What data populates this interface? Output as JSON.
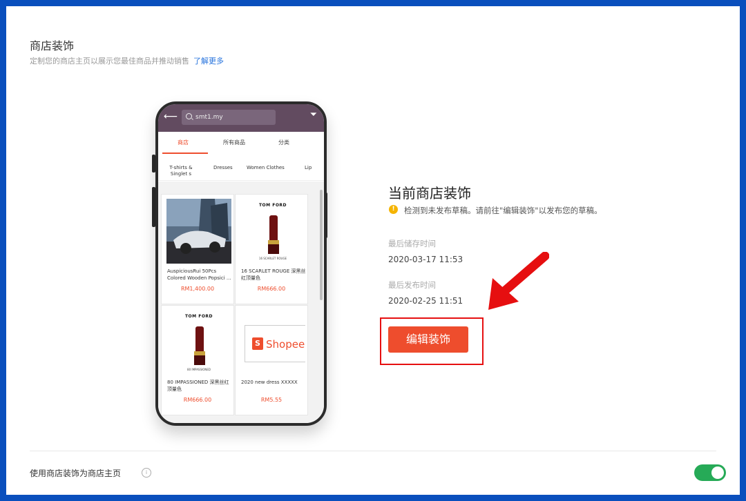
{
  "header": {
    "title": "商店装饰",
    "subtitle": "定制您的商店主页以展示您最佳商品并推动销售",
    "learn_more": "了解更多"
  },
  "phone": {
    "search_text": "smt1.my",
    "tabs": [
      "商店",
      "所有商品",
      "分类"
    ],
    "categories": [
      "T-shirts & Singlet s",
      "Dresses",
      "Women Clothes",
      "Lip"
    ],
    "products": [
      {
        "name": "AuspiciousRui 50Pcs Colored Wooden Popsici ...",
        "price": "RM1,400.00",
        "image": "car-photo"
      },
      {
        "name": "16 SCARLET ROUGE 深黑丝红顶量色",
        "price": "RM666.00",
        "image": "tom-ford-lipstick",
        "brand": "TOM FORD",
        "shade": "16 SCARLET ROUGE"
      },
      {
        "name": "80 IMPASSIONED 深黑丝红顶量色",
        "price": "RM666.00",
        "image": "tom-ford-lipstick",
        "brand": "TOM FORD",
        "shade": "80 IMPASSIONED"
      },
      {
        "name": "2020 new dress XXXXX",
        "price": "RM5.55",
        "image": "shopee-logo",
        "logo_text": "Shopee"
      }
    ]
  },
  "panel": {
    "title": "当前商店装饰",
    "warning": "检测到未发布草稿。请前往\"编辑装饰\"以发布您的草稿。",
    "last_saved_label": "最后储存时间",
    "last_saved_value": "2020-03-17 11:53",
    "last_published_label": "最后发布时间",
    "last_published_value": "2020-02-25 11:51",
    "edit_button": "编辑装饰"
  },
  "footer": {
    "toggle_label": "使用商店装饰为商店主页",
    "toggle_on": true
  },
  "colors": {
    "accent": "#ee4d2d",
    "toggle": "#26aa57",
    "link": "#2673dd",
    "frame": "#0a4fbd",
    "highlight": "#e60f10"
  }
}
